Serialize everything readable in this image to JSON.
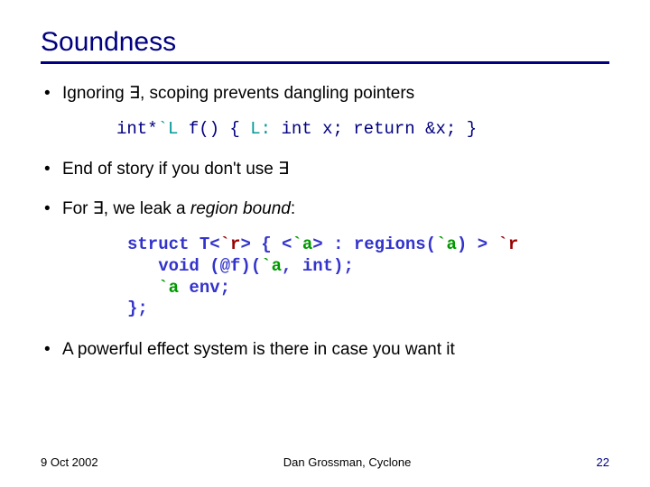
{
  "title": "Soundness",
  "bullets": {
    "b1_pre": "Ignoring ",
    "b1_sym": "∃",
    "b1_post": ", scoping prevents dangling pointers",
    "b2_pre": "End of story if you don't use ",
    "b2_sym": "∃",
    "b3_pre": "For ",
    "b3_sym": "∃",
    "b3_post": ", we leak a ",
    "b3_em": "region bound",
    "b3_end": ":",
    "b4": "A powerful effect system is there in case you want it"
  },
  "code1": {
    "seg1": "int*",
    "seg2": "`L",
    "seg3": " f() { ",
    "seg4": "L:",
    "seg5": " int x; return &x; }"
  },
  "code2": {
    "l1a": "struct T<",
    "l1b": "`r",
    "l1c": "> { <",
    "l1d": "`a",
    "l1e": "> : regions(",
    "l1f": "`a",
    "l1g": ") > ",
    "l1h": "`r",
    "l2a": "   void (@f)(",
    "l2b": "`a",
    "l2c": ", int);",
    "l3a": "   ",
    "l3b": "`a",
    "l3c": " env;",
    "l4": "};"
  },
  "footer": {
    "date": "9 Oct 2002",
    "center": "Dan Grossman, Cyclone",
    "page": "22"
  }
}
